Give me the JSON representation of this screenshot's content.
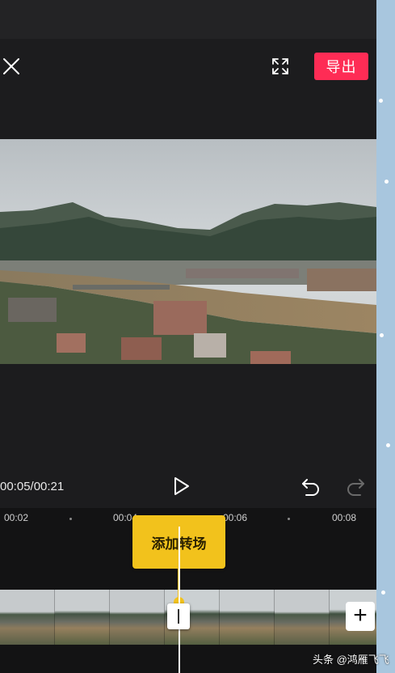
{
  "header": {
    "close_icon": "close-icon",
    "fullscreen_icon": "fullscreen-icon",
    "export_label": "导出",
    "accent_color": "#fe2c55"
  },
  "player": {
    "timecode": "00:05/00:21",
    "play_icon": "play-icon",
    "undo_icon": "undo-icon",
    "redo_icon": "redo-icon"
  },
  "timeline": {
    "ticks": [
      "00:02",
      "00:04",
      "00:06",
      "00:08"
    ],
    "transition_tooltip": "添加转场",
    "add_clip_icon": "plus-icon",
    "add_clip_label": "+",
    "tooltip_color": "#f2c21c"
  },
  "watermark": "头条 @鸿雁飞飞"
}
